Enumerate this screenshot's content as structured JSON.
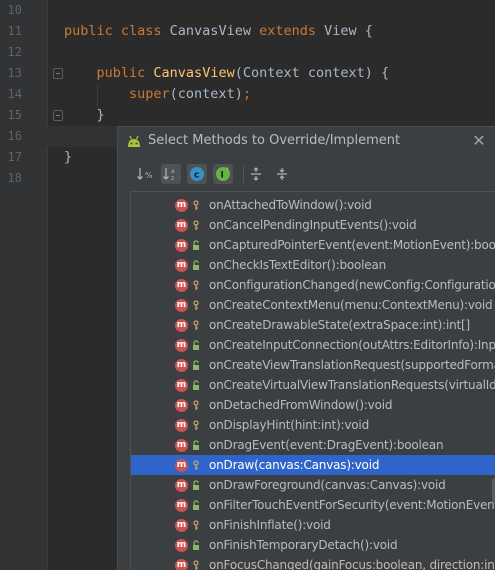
{
  "editor": {
    "lines": [
      {
        "num": "10",
        "tokens": []
      },
      {
        "num": "11",
        "tokens": [
          {
            "t": "kw",
            "v": "public class "
          },
          {
            "t": "plain",
            "v": "CanvasView "
          },
          {
            "t": "kw",
            "v": "extends "
          },
          {
            "t": "plain",
            "v": "View {"
          }
        ]
      },
      {
        "num": "12",
        "tokens": []
      },
      {
        "num": "13",
        "tokens": [
          {
            "t": "plain",
            "v": "    "
          },
          {
            "t": "kw",
            "v": "public "
          },
          {
            "t": "fn",
            "v": "CanvasView"
          },
          {
            "t": "plain",
            "v": "(Context context) {"
          }
        ]
      },
      {
        "num": "14",
        "tokens": [
          {
            "t": "plain",
            "v": "        "
          },
          {
            "t": "kw",
            "v": "super"
          },
          {
            "t": "plain",
            "v": "(context)"
          },
          {
            "t": "kw",
            "v": ";"
          }
        ]
      },
      {
        "num": "15",
        "tokens": [
          {
            "t": "plain",
            "v": "    }"
          }
        ]
      },
      {
        "num": "16",
        "tokens": []
      },
      {
        "num": "17",
        "tokens": [
          {
            "t": "plain",
            "v": "}"
          }
        ]
      },
      {
        "num": "18",
        "tokens": []
      }
    ]
  },
  "dialog": {
    "title": "Select Methods to Override/Implement",
    "toolbar": [
      {
        "icon": "sort-by-visibility-icon",
        "glyph": "↓%"
      },
      {
        "icon": "sort-alphabetically-icon",
        "glyph": "↓a"
      },
      {
        "icon": "show-classes-icon",
        "glyph": "c"
      },
      {
        "icon": "show-interfaces-icon",
        "glyph": "I"
      },
      {
        "icon": "expand-all-icon",
        "glyph": "⇕"
      },
      {
        "icon": "collapse-all-icon",
        "glyph": "⇔"
      }
    ],
    "methods": [
      {
        "label": "onAttachedToWindow():void",
        "vis": "protected"
      },
      {
        "label": "onCancelPendingInputEvents():void",
        "vis": "protected"
      },
      {
        "label": "onCapturedPointerEvent(event:MotionEvent):boolean",
        "vis": "public"
      },
      {
        "label": "onCheckIsTextEditor():boolean",
        "vis": "public"
      },
      {
        "label": "onConfigurationChanged(newConfig:Configuration):void",
        "vis": "protected"
      },
      {
        "label": "onCreateContextMenu(menu:ContextMenu):void",
        "vis": "protected"
      },
      {
        "label": "onCreateDrawableState(extraSpace:int):int[]",
        "vis": "protected"
      },
      {
        "label": "onCreateInputConnection(outAttrs:EditorInfo):InputConnection",
        "vis": "public"
      },
      {
        "label": "onCreateViewTranslationRequest(supportedFormats:int[])",
        "vis": "public"
      },
      {
        "label": "onCreateVirtualViewTranslationRequests(virtualIds:long[])",
        "vis": "public"
      },
      {
        "label": "onDetachedFromWindow():void",
        "vis": "protected"
      },
      {
        "label": "onDisplayHint(hint:int):void",
        "vis": "protected"
      },
      {
        "label": "onDragEvent(event:DragEvent):boolean",
        "vis": "public"
      },
      {
        "label": "onDraw(canvas:Canvas):void",
        "vis": "protected",
        "selected": true
      },
      {
        "label": "onDrawForeground(canvas:Canvas):void",
        "vis": "public"
      },
      {
        "label": "onFilterTouchEventForSecurity(event:MotionEvent):boolean",
        "vis": "public"
      },
      {
        "label": "onFinishInflate():void",
        "vis": "protected"
      },
      {
        "label": "onFinishTemporaryDetach():void",
        "vis": "public"
      },
      {
        "label": "onFocusChanged(gainFocus:boolean, direction:int, previouslyFocusedRect:Rect):void",
        "vis": "protected"
      }
    ]
  },
  "colors": {
    "selection": "#2f65ca",
    "method_badge": "#c75450",
    "android_green": "#a4c639"
  }
}
